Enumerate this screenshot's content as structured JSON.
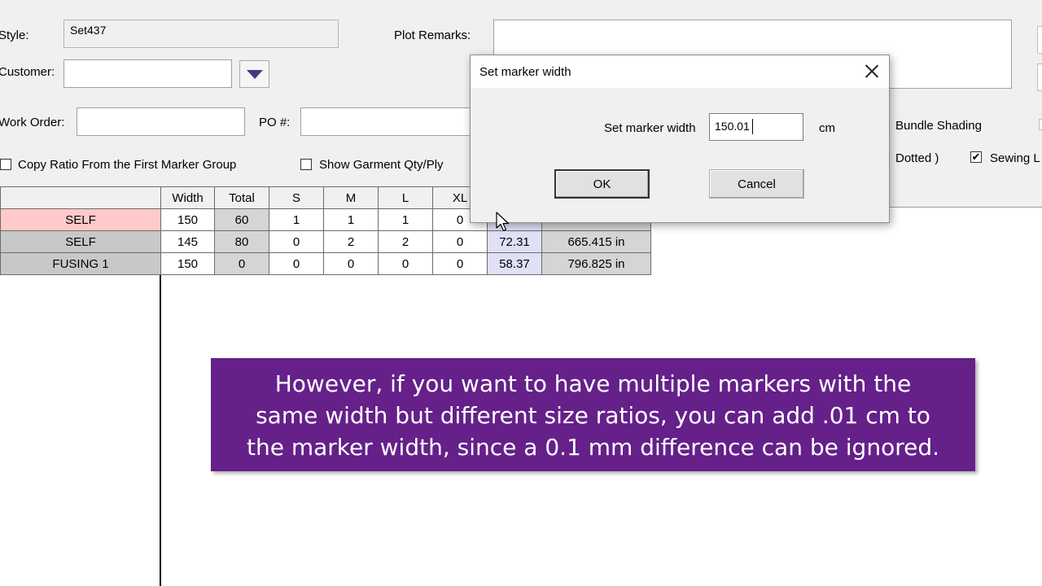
{
  "form": {
    "style_label": "Style:",
    "style_value": "Set437",
    "plot_remarks_label": "Plot Remarks:",
    "customer_label": "Customer:",
    "customer_value": "",
    "work_order_label": "Work Order:",
    "work_order_value": "",
    "po_label": "PO #:",
    "po_value": "",
    "copy_ratio_label": "Copy Ratio From the First Marker Group",
    "copy_ratio_checked": false,
    "show_qty_label": "Show Garment Qty/Ply",
    "show_qty_checked": false,
    "bundle_shading_label": "Bundle Shading",
    "dotted_label": "Dotted )",
    "sewing_label": "Sewing L",
    "sewing_checked": true,
    "check_mark": "✔"
  },
  "grid": {
    "headers": [
      "",
      "Width",
      "Total",
      "S",
      "M",
      "L",
      "XL",
      "",
      ""
    ],
    "rows": [
      {
        "name": "SELF",
        "width": "150",
        "total": "60",
        "s": "1",
        "m": "1",
        "l": "1",
        "xl": "0",
        "length": "",
        "perimeter": "",
        "selected": true
      },
      {
        "name": "SELF",
        "width": "145",
        "total": "80",
        "s": "0",
        "m": "2",
        "l": "2",
        "xl": "0",
        "length": "72.31",
        "perimeter": "665.415 in",
        "selected": false
      },
      {
        "name": "FUSING 1",
        "width": "150",
        "total": "0",
        "s": "0",
        "m": "0",
        "l": "0",
        "xl": "0",
        "length": "58.37",
        "perimeter": "796.825 in",
        "selected": false
      }
    ]
  },
  "dialog": {
    "title": "Set marker width",
    "field_label": "Set marker width",
    "field_value": "150.01",
    "unit": "cm",
    "ok_label": "OK",
    "cancel_label": "Cancel"
  },
  "caption": {
    "lines": [
      "However, if you want to have multiple markers with the",
      "same width but different size ratios, you can add .01 cm to",
      "the marker width, since a 0.1 mm difference can be ignored."
    ]
  }
}
